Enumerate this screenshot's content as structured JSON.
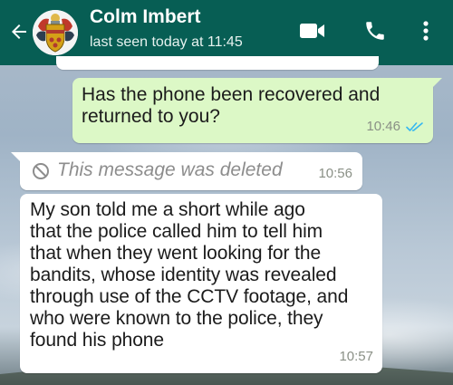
{
  "header": {
    "contact_name": "Colm Imbert",
    "last_seen": "last seen today at 11:45",
    "back_icon": "back-arrow-icon",
    "avatar": "coat-of-arms",
    "actions": [
      "video-call-icon",
      "voice-call-icon",
      "more-options-icon"
    ],
    "color": "#075e54"
  },
  "messages": [
    {
      "direction": "outgoing",
      "lines": [
        "Has the phone been recovered and",
        "returned to you?"
      ],
      "time": "10:46",
      "status": "read",
      "bubble_color": "#dcf8c6",
      "tick_color": "#34b7f1"
    },
    {
      "direction": "incoming",
      "deleted": true,
      "text": "This message was deleted",
      "time": "10:56"
    },
    {
      "direction": "incoming",
      "lines": [
        "My son told me a short while ago",
        "that the police called him to tell him",
        "that when they went looking for the",
        "bandits, whose identity was revealed",
        "through use of the CCTV footage, and",
        "who were known to the police, they",
        "found his phone"
      ],
      "time": "10:57"
    }
  ]
}
